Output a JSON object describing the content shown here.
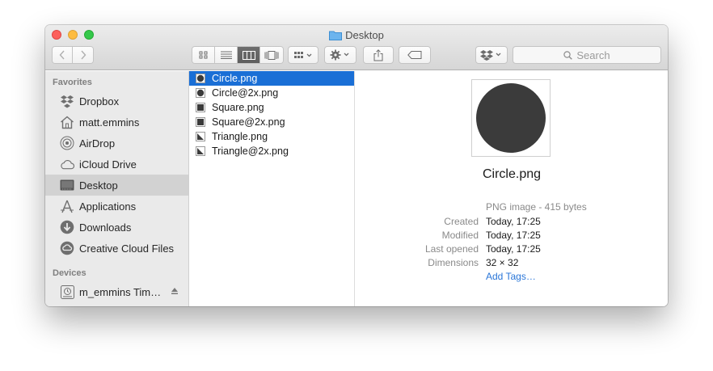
{
  "window": {
    "title": "Desktop"
  },
  "toolbar": {
    "search_placeholder": "Search",
    "icons": [
      "back-icon",
      "forward-icon",
      "icon-view-icon",
      "list-view-icon",
      "column-view-icon",
      "cover-flow-icon",
      "arrange-icon",
      "action-gear-icon",
      "share-icon",
      "tag-icon",
      "dropbox-icon"
    ]
  },
  "sidebar": {
    "favorites_header": "Favorites",
    "favorites": [
      {
        "label": "Dropbox",
        "icon": "dropbox-icon"
      },
      {
        "label": "matt.emmins",
        "icon": "home-icon"
      },
      {
        "label": "AirDrop",
        "icon": "airdrop-icon"
      },
      {
        "label": "iCloud Drive",
        "icon": "cloud-icon"
      },
      {
        "label": "Desktop",
        "icon": "desktop-icon",
        "selected": true
      },
      {
        "label": "Applications",
        "icon": "applications-icon"
      },
      {
        "label": "Downloads",
        "icon": "downloads-icon"
      },
      {
        "label": "Creative Cloud Files",
        "icon": "creative-cloud-icon"
      }
    ],
    "devices_header": "Devices",
    "devices": [
      {
        "label": "m_emmins Tim…",
        "icon": "time-machine-icon"
      }
    ]
  },
  "files": [
    {
      "name": "Circle.png",
      "icon": "circle-file-icon",
      "selected": true
    },
    {
      "name": "Circle@2x.png",
      "icon": "circle-file-icon"
    },
    {
      "name": "Square.png",
      "icon": "square-file-icon"
    },
    {
      "name": "Square@2x.png",
      "icon": "square-file-icon"
    },
    {
      "name": "Triangle.png",
      "icon": "triangle-file-icon"
    },
    {
      "name": "Triangle@2x.png",
      "icon": "triangle-file-icon"
    }
  ],
  "preview": {
    "filename": "Circle.png",
    "kind": "PNG image - 415 bytes",
    "meta": [
      {
        "label": "Created",
        "value": "Today, 17:25"
      },
      {
        "label": "Modified",
        "value": "Today, 17:25"
      },
      {
        "label": "Last opened",
        "value": "Today, 17:25"
      },
      {
        "label": "Dimensions",
        "value": "32 × 32"
      }
    ],
    "add_tags": "Add Tags…"
  },
  "colors": {
    "selection_blue": "#1a6fd6",
    "sidebar_bg": "#eaeaea",
    "link_blue": "#2a76d8"
  }
}
